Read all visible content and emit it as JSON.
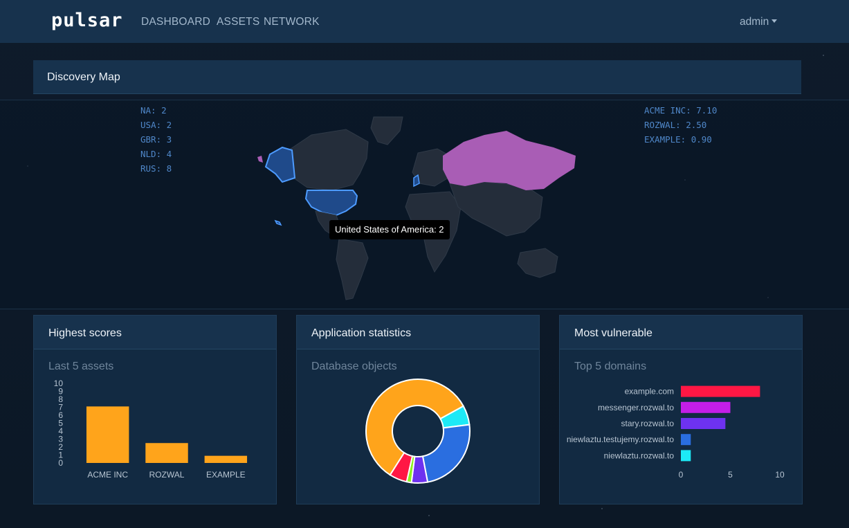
{
  "navbar": {
    "brand": "pulsar",
    "links": [
      "DASHBOARD",
      "ASSETS",
      "NETWORK"
    ],
    "user": "admin"
  },
  "map": {
    "title": "Discovery Map",
    "country_counts": [
      "NA: 2",
      "USA: 2",
      "GBR: 3",
      "NLD: 4",
      "RUS: 8"
    ],
    "company_scores": [
      "ACME INC: 7.10",
      "ROZWAL: 2.50",
      "EXAMPLE: 0.90"
    ],
    "tooltip": "United States of America: 2",
    "colors": {
      "usa": "#1f4a8a",
      "usa_border": "#4d9bff",
      "russia": "#a95db5",
      "land": "#242d3a"
    }
  },
  "cards": {
    "scores": {
      "title": "Highest scores",
      "subtitle": "Last 5 assets"
    },
    "stats": {
      "title": "Application statistics",
      "subtitle": "Database objects"
    },
    "vulnerable": {
      "title": "Most vulnerable",
      "subtitle": "Top 5 domains"
    }
  },
  "chart_data": [
    {
      "type": "bar",
      "categories": [
        "ACME INC",
        "ROZWAL",
        "EXAMPLE"
      ],
      "values": [
        7.1,
        2.5,
        0.9
      ],
      "ylim": [
        0,
        10
      ],
      "yticks": [
        0,
        1,
        2,
        3,
        4,
        5,
        6,
        7,
        8,
        9,
        10
      ],
      "color": "#ffa41b"
    },
    {
      "type": "pie",
      "donut": true,
      "values": [
        58,
        6,
        24,
        5,
        1.5,
        5.5
      ],
      "colors": [
        "#ffa41b",
        "#1de9f6",
        "#2a6ee0",
        "#6e32f0",
        "#8cf21f",
        "#ff1744"
      ]
    },
    {
      "type": "bar",
      "orientation": "horizontal",
      "categories": [
        "example.com",
        "messenger.rozwal.to",
        "stary.rozwal.to",
        "niewlaztu.testujemy.rozwal.to",
        "niewlaztu.rozwal.to"
      ],
      "values": [
        8,
        5,
        4.5,
        1,
        1
      ],
      "xlim": [
        0,
        10
      ],
      "xticks": [
        0,
        5,
        10
      ],
      "colors": [
        "#ff1744",
        "#c41ee8",
        "#6e32f0",
        "#2a6ee0",
        "#1de9f6"
      ]
    }
  ]
}
